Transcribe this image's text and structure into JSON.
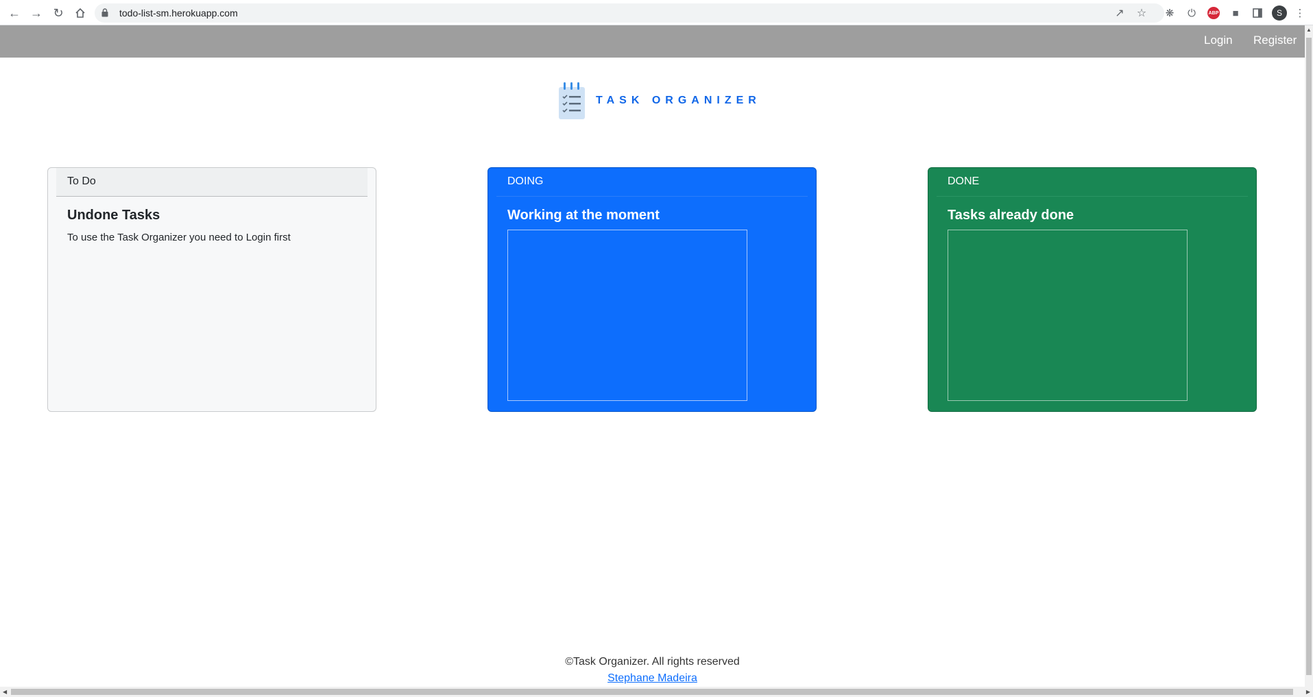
{
  "browser": {
    "url": "todo-list-sm.herokuapp.com",
    "profile_initial": "S",
    "abp_label": "ABP"
  },
  "nav": {
    "login": "Login",
    "register": "Register"
  },
  "logo": {
    "text": "TASK ORGANIZER"
  },
  "columns": [
    {
      "header": "To Do",
      "title": "Undone Tasks",
      "text": "To use the Task Organizer you need to Login first"
    },
    {
      "header": "DOING",
      "title": "Working at the moment"
    },
    {
      "header": "DONE",
      "title": "Tasks already done"
    }
  ],
  "footer": {
    "copyright": "©Task Organizer. All rights reserved",
    "author": "Stephane Madeira"
  },
  "colors": {
    "navbar": "#9e9e9e",
    "doing": "#0d6efd",
    "done": "#198754",
    "logo": "#1167e8"
  }
}
